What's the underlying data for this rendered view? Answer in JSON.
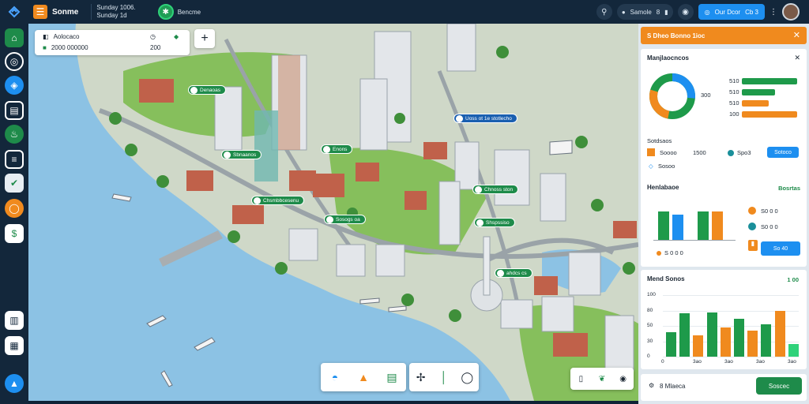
{
  "topbar": {
    "app_name": "Sonme",
    "info_line1": "Sunday 1006.",
    "info_line2": "Sunday 1d",
    "status_label": "Bencme",
    "user_label": "Samole",
    "user_count": "8",
    "primary_label": "Our Dcor",
    "primary_value": "Cb 3"
  },
  "map_card": {
    "row1_label": "Aolocaco",
    "row2_label": "2000 000000",
    "row2_value": "200"
  },
  "pins": [
    {
      "label": "Denaoas"
    },
    {
      "label": "Sbnaanos"
    },
    {
      "label": "Enons"
    },
    {
      "label": "Uoss ot 1e stotlecho"
    },
    {
      "label": "Chnoss ston"
    },
    {
      "label": "Chsmbbcesenu"
    },
    {
      "label": "Sosogs oa"
    },
    {
      "label": "Shspssiso"
    },
    {
      "label": "ahdcs cs"
    }
  ],
  "panel": {
    "header": "S Dheo Bonno 1ioc",
    "card1": {
      "title": "Manjlaocncos",
      "donut_value": "300",
      "bars": [
        {
          "label": "510",
          "value": 100,
          "color": "#1e9a4a"
        },
        {
          "label": "510",
          "value": 60,
          "color": "#1e9a4a"
        },
        {
          "label": "510",
          "value": 48,
          "color": "#f08a1e"
        },
        {
          "label": "100",
          "value": 100,
          "color": "#f08a1e"
        }
      ],
      "subtitle": "Sotdsaos",
      "legend1_label": "Soooo",
      "legend1_value": "1500",
      "legend2_value": "Spo3",
      "button": "Sotoco",
      "footer_note": "Sosoo"
    },
    "card2": {
      "title": "Henlabaoe",
      "subtitle": "Bosrtas",
      "bars": [
        {
          "value": 34,
          "color": "#1e9a4a"
        },
        {
          "value": 30,
          "color": "#1d8ff0"
        },
        {
          "value": 34,
          "color": "#1e9a4a"
        },
        {
          "value": 34,
          "color": "#f08a1e"
        }
      ],
      "legend1": "S0 0 0",
      "legend2": "S0 0 0",
      "legend3": "S 0 0 0",
      "button": "So 40"
    },
    "card3": {
      "title": "Mend Sonos",
      "value": "1 00",
      "yticks": [
        "100",
        "80",
        "50",
        "30",
        "0"
      ],
      "xticks": [
        "0",
        "3ao",
        "3ao",
        "3ao",
        "3ao"
      ],
      "bars": [
        {
          "value": 40,
          "color": "#1e9a4a"
        },
        {
          "value": 70,
          "color": "#1e9a4a"
        },
        {
          "value": 35,
          "color": "#f08a1e"
        },
        {
          "value": 72,
          "color": "#1e9a4a"
        },
        {
          "value": 48,
          "color": "#f08a1e"
        },
        {
          "value": 62,
          "color": "#1e9a4a"
        },
        {
          "value": 42,
          "color": "#f08a1e"
        },
        {
          "value": 52,
          "color": "#1e9a4a"
        },
        {
          "value": 74,
          "color": "#f08a1e"
        },
        {
          "value": 20,
          "color": "#2fd27a"
        }
      ]
    },
    "footer": {
      "label": "8 Mlaeca",
      "button": "Soscec"
    }
  },
  "colors": {
    "topbar_bg": "#13273b",
    "accent_orange": "#f08a1e",
    "accent_green": "#1e8b4a",
    "accent_blue": "#1d8ff0",
    "water": "#8cc2e4"
  }
}
